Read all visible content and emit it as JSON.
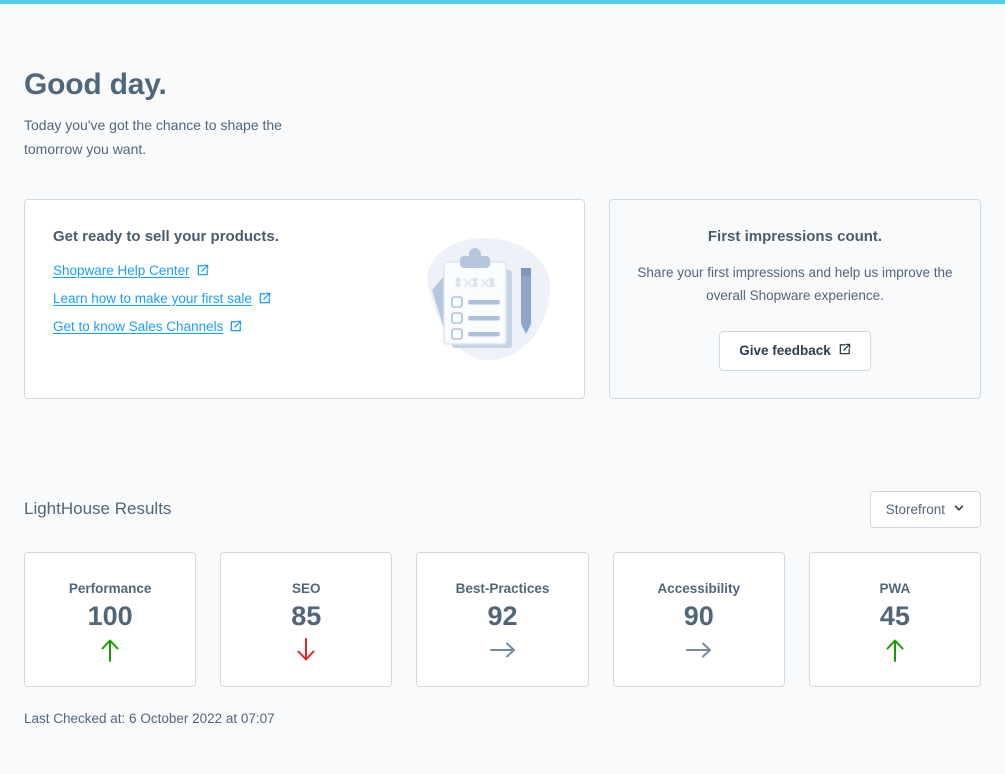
{
  "theme": {
    "accent_bar": "#54d0ec",
    "page_background": "#f9fafb",
    "text": "#52667a",
    "link": "#189eff",
    "border": "#d1d9e0",
    "trend_up": "#169e00",
    "trend_down": "#e52427",
    "trend_flat": "#758ca3"
  },
  "greeting": {
    "title": "Good day.",
    "subtitle": "Today you've got the chance to shape the tomorrow you want."
  },
  "cards": {
    "get_ready": {
      "heading": "Get ready to sell your products.",
      "links": [
        {
          "label": "Shopware Help Center",
          "icon": "external-link-icon"
        },
        {
          "label": "Learn how to make your first sale",
          "icon": "external-link-icon"
        },
        {
          "label": "Get to know Sales Channels",
          "icon": "external-link-icon"
        }
      ],
      "illustration": "clipboard-checklist-illustration"
    },
    "first_impressions": {
      "heading": "First impressions count.",
      "body": "Share your first impressions and help us improve the overall Shopware experience.",
      "button_label": "Give feedback",
      "button_icon": "external-link-icon"
    }
  },
  "lighthouse": {
    "title": "LightHouse Results",
    "sales_channel_selected": "Storefront",
    "sales_channel_icon": "chevron-down-icon",
    "last_checked": "Last Checked at: 6 October 2022 at 07:07",
    "scores": [
      {
        "label": "Performance",
        "value": "100",
        "trend": "up",
        "trend_icon": "arrow-up-icon"
      },
      {
        "label": "SEO",
        "value": "85",
        "trend": "down",
        "trend_icon": "arrow-down-icon"
      },
      {
        "label": "Best-Practices",
        "value": "92",
        "trend": "flat",
        "trend_icon": "arrow-right-icon"
      },
      {
        "label": "Accessibility",
        "value": "90",
        "trend": "flat",
        "trend_icon": "arrow-right-icon"
      },
      {
        "label": "PWA",
        "value": "45",
        "trend": "up",
        "trend_icon": "arrow-up-icon"
      }
    ]
  }
}
